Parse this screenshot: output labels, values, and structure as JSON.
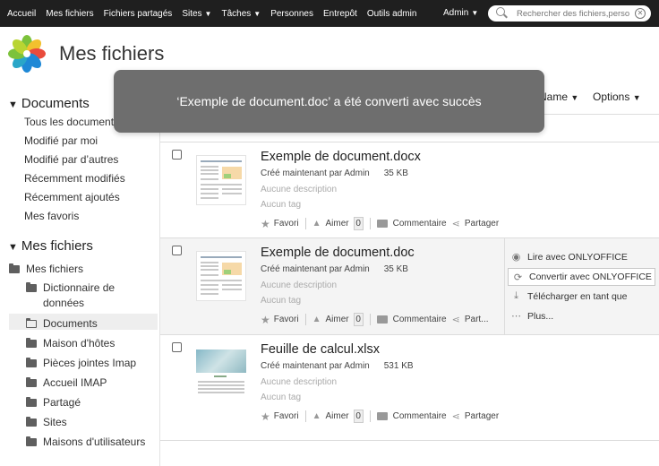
{
  "topbar": {
    "nav": [
      {
        "label": "Accueil",
        "dropdown": false
      },
      {
        "label": "Mes fichiers",
        "dropdown": false
      },
      {
        "label": "Fichiers partagés",
        "dropdown": false
      },
      {
        "label": "Sites",
        "dropdown": true
      },
      {
        "label": "Tâches",
        "dropdown": true
      },
      {
        "label": "Personnes",
        "dropdown": false
      },
      {
        "label": "Entrepôt",
        "dropdown": false
      },
      {
        "label": "Outils admin",
        "dropdown": false
      }
    ],
    "user_label": "Admin",
    "search_placeholder": "Rechercher des fichiers,perso"
  },
  "header": {
    "page_title": "Mes fichiers"
  },
  "toast": {
    "message": "‘Exemple de document.doc’ a été converti avec succès"
  },
  "toolbar": {
    "name_sort_partial": "Name",
    "options_label": "Options"
  },
  "sidebar": {
    "documents_section": {
      "title": "Documents",
      "items": [
        "Tous les documents",
        "Modifié par moi",
        "Modifié par d’autres",
        "Récemment modifiés",
        "Récemment ajoutés",
        "Mes favoris"
      ]
    },
    "myfiles_section": {
      "title": "Mes fichiers",
      "root": "Mes fichiers",
      "folders": [
        {
          "label": "Dictionnaire de\ndonnées",
          "selected": false
        },
        {
          "label": "Documents",
          "selected": true
        },
        {
          "label": "Maison d'hôtes",
          "selected": false
        },
        {
          "label": "Pièces jointes Imap",
          "selected": false
        },
        {
          "label": "Accueil IMAP",
          "selected": false
        },
        {
          "label": "Partagé",
          "selected": false
        },
        {
          "label": "Sites",
          "selected": false
        },
        {
          "label": "Maisons d'utilisateurs",
          "selected": false
        }
      ]
    }
  },
  "files": [
    {
      "name": "Exemple de document.docx",
      "created": "Créé maintenant par Admin",
      "size": "35 KB",
      "description": "Aucune description",
      "tags": "Aucun tag",
      "favorite_label": "Favori",
      "like_label": "Aimer",
      "like_count": "0",
      "comment_label": "Commentaire",
      "share_label": "Partager",
      "thumb": "document"
    },
    {
      "name": "Exemple de document.doc",
      "created": "Créé maintenant par Admin",
      "size": "35 KB",
      "description": "Aucune description",
      "tags": "Aucun tag",
      "favorite_label": "Favori",
      "like_label": "Aimer",
      "like_count": "0",
      "comment_label": "Commentaire",
      "share_label": "Part...",
      "thumb": "document"
    },
    {
      "name": "Feuille de calcul.xlsx",
      "created": "Créé maintenant par Admin",
      "size": "531 KB",
      "description": "Aucune description",
      "tags": "Aucun tag",
      "favorite_label": "Favori",
      "like_label": "Aimer",
      "like_count": "0",
      "comment_label": "Commentaire",
      "share_label": "Partager",
      "thumb": "spreadsheet"
    }
  ],
  "actions_panel": {
    "items": [
      {
        "label": "Lire avec ONLYOFFICE",
        "icon": "eye-icon"
      },
      {
        "label": "Convertir avec ONLYOFFICE",
        "icon": "convert-icon"
      },
      {
        "label": "Télécharger en tant que",
        "icon": "download-icon"
      },
      {
        "label": "Plus...",
        "icon": "more-icon"
      }
    ]
  },
  "colors": {
    "topbar_bg": "#1f1f1f",
    "toast_bg": "#6e6e6e",
    "row_highlight": "#f4f4f4",
    "logo_blue": "#1e88d6",
    "logo_green": "#7cc23b",
    "logo_yellow": "#f2c12e"
  }
}
